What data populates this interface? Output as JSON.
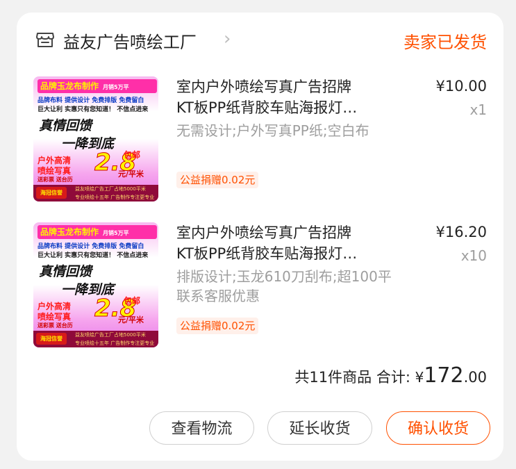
{
  "store": {
    "name": "益友广告喷绘工厂",
    "icon": "store-icon",
    "arrow": "›"
  },
  "order_status": "卖家已发货",
  "thumbnail": {
    "banner": "品牌玉龙布制作",
    "banner_small": "月销5万平",
    "line1": "品牌布料 提供设计 免费排版 免费留白",
    "line2": "巨大让利 实惠只有您知道！ 不信点进来",
    "big1": "真情回馈",
    "big2": "一降到底",
    "red1": "户外高清",
    "red2": "喷绘写真",
    "price": "2.8",
    "pack": "包邮",
    "unit": "元/平米",
    "ticket": "送彩票 送台历",
    "badge": "海冠信誉",
    "footer1": "益友喷绘广告工厂占地5000平米",
    "footer2": "专业喷绘十五年 广告制作专注更专业"
  },
  "items": [
    {
      "title_line1": "室内户外喷绘写真广告招牌",
      "title_line2": "KT板PP纸背胶车贴海报灯…",
      "spec": "无需设计;户外写真PP纸;空白布",
      "charity": "公益捐赠0.02元",
      "price": "¥10.00",
      "qty": "x1"
    },
    {
      "title_line1": "室内户外喷绘写真广告招牌",
      "title_line2": "KT板PP纸背胶车贴海报灯…",
      "spec": "排版设计;玉龙610刀刮布;超100平联系客服优惠",
      "charity": "公益捐赠0.02元",
      "price": "¥16.20",
      "qty": "x10"
    }
  ],
  "summary": {
    "count_text": "共11件商品",
    "total_label": "合计:",
    "currency": "¥",
    "total_int": "172",
    "total_dec": ".00"
  },
  "buttons": {
    "logistics": "查看物流",
    "extend": "延长收货",
    "confirm": "确认收货"
  },
  "colors": {
    "accent": "#ff5000",
    "muted": "#9e9e9e"
  }
}
